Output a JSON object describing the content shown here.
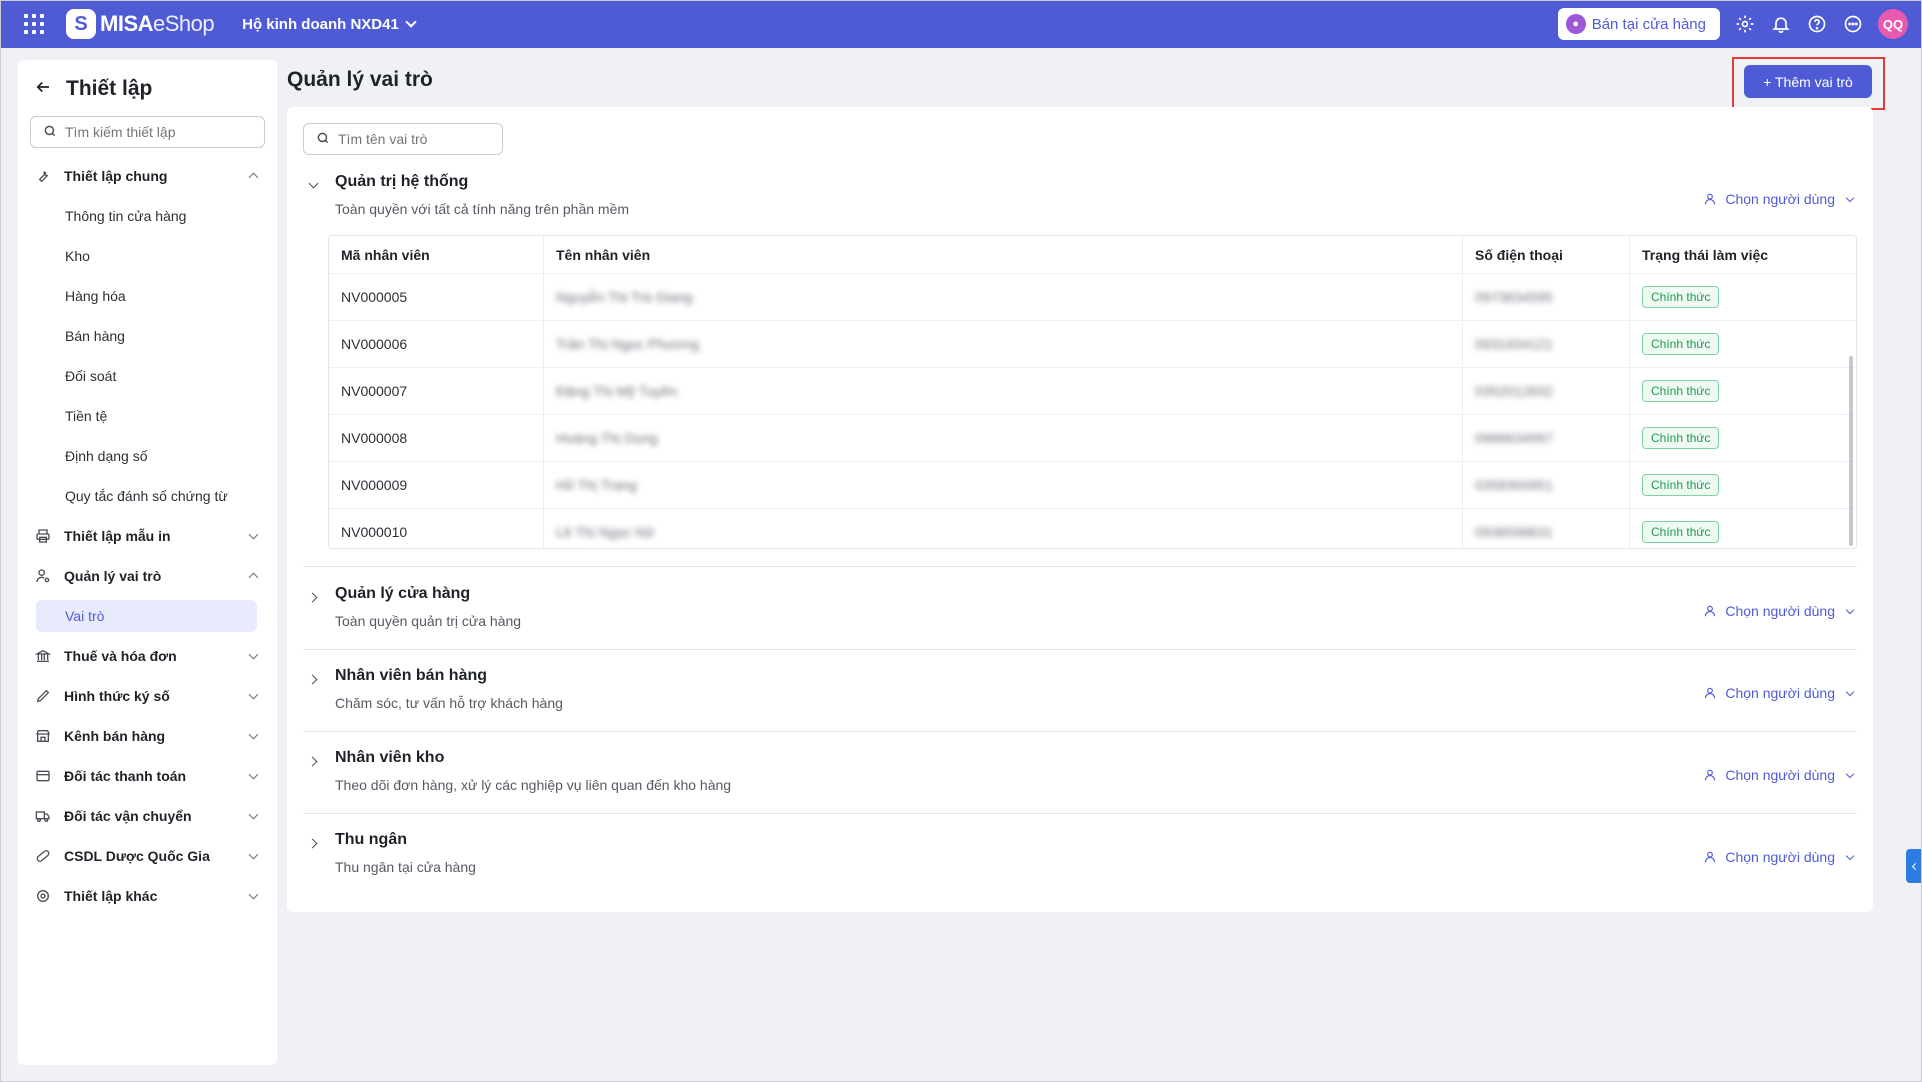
{
  "app": {
    "logo_text_bold": "MISA",
    "logo_text_light": "eShop",
    "business_name": "Hộ kinh doanh NXD41",
    "shop_button_label": "Bán tại cửa hàng",
    "avatar_initials": "QQ",
    "brand_color": "#4f5bd5"
  },
  "sidebar": {
    "title": "Thiết lập",
    "search_placeholder": "Tìm kiếm thiết lập",
    "groups": [
      {
        "label": "Thiết lập chung",
        "icon": "wrench-icon",
        "expanded": true
      },
      {
        "label": "Thiết lập mẫu in",
        "icon": "printer-icon",
        "expanded": false
      },
      {
        "label": "Quản lý vai trò",
        "icon": "user-gear-icon",
        "expanded": true
      },
      {
        "label": "Thuế và hóa đơn",
        "icon": "bank-icon",
        "expanded": false
      },
      {
        "label": "Hình thức ký số",
        "icon": "pen-icon",
        "expanded": false
      },
      {
        "label": "Kênh bán hàng",
        "icon": "store-icon",
        "expanded": false
      },
      {
        "label": "Đối tác thanh toán",
        "icon": "card-icon",
        "expanded": false
      },
      {
        "label": "Đối tác vận chuyển",
        "icon": "truck-icon",
        "expanded": false
      },
      {
        "label": "CSDL Dược Quốc Gia",
        "icon": "pill-icon",
        "expanded": false
      },
      {
        "label": "Thiết lập khác",
        "icon": "gear-icon",
        "expanded": false
      }
    ],
    "general_items": [
      "Thông tin cửa hàng",
      "Kho",
      "Hàng hóa",
      "Bán hàng",
      "Đối soát",
      "Tiền tệ",
      "Định dạng số",
      "Quy tắc đánh số chứng từ"
    ],
    "role_items": [
      "Vai trò"
    ]
  },
  "main": {
    "title": "Quản lý vai trò",
    "add_button_label": "+ Thêm vai trò",
    "role_search_placeholder": "Tìm tên vai trò",
    "pick_user_label": "Chọn người dùng",
    "roles": [
      {
        "name": "Quản trị hệ thống",
        "description": "Toàn quyền với tất cả tính năng trên phần mềm",
        "expanded": true
      },
      {
        "name": "Quản lý cửa hàng",
        "description": "Toàn quyền quản trị cửa hàng",
        "expanded": false
      },
      {
        "name": "Nhân viên bán hàng",
        "description": "Chăm sóc, tư vấn hỗ trợ khách hàng",
        "expanded": false
      },
      {
        "name": "Nhân viên kho",
        "description": "Theo dõi đơn hàng, xử lý các nghiệp vụ liên quan đến kho hàng",
        "expanded": false
      },
      {
        "name": "Thu ngân",
        "description": "Thu ngân tại cửa hàng",
        "expanded": false
      }
    ],
    "table": {
      "headers": [
        "Mã nhân viên",
        "Tên nhân viên",
        "Số điện thoại",
        "Trạng thái làm việc"
      ],
      "rows": [
        {
          "code": "NV000005",
          "name": "Nguyễn Thị Trà Giang",
          "phone": "0973634595",
          "status": "Chính thức"
        },
        {
          "code": "NV000006",
          "name": "Trần Thị Ngọc Phương",
          "phone": "0931934121",
          "status": "Chính thức"
        },
        {
          "code": "NV000007",
          "name": "Đặng Thị Mỹ Tuyền",
          "phone": "0352012832",
          "status": "Chính thức"
        },
        {
          "code": "NV000008",
          "name": "Hoàng Thị Dung",
          "phone": "0966634997",
          "status": "Chính thức"
        },
        {
          "code": "NV000009",
          "name": "Hồ Thị Trang",
          "phone": "0358300951",
          "status": "Chính thức"
        },
        {
          "code": "NV000010",
          "name": "Lê Thị Ngọc Nữ",
          "phone": "0938598631",
          "status": "Chính thức"
        }
      ]
    }
  }
}
